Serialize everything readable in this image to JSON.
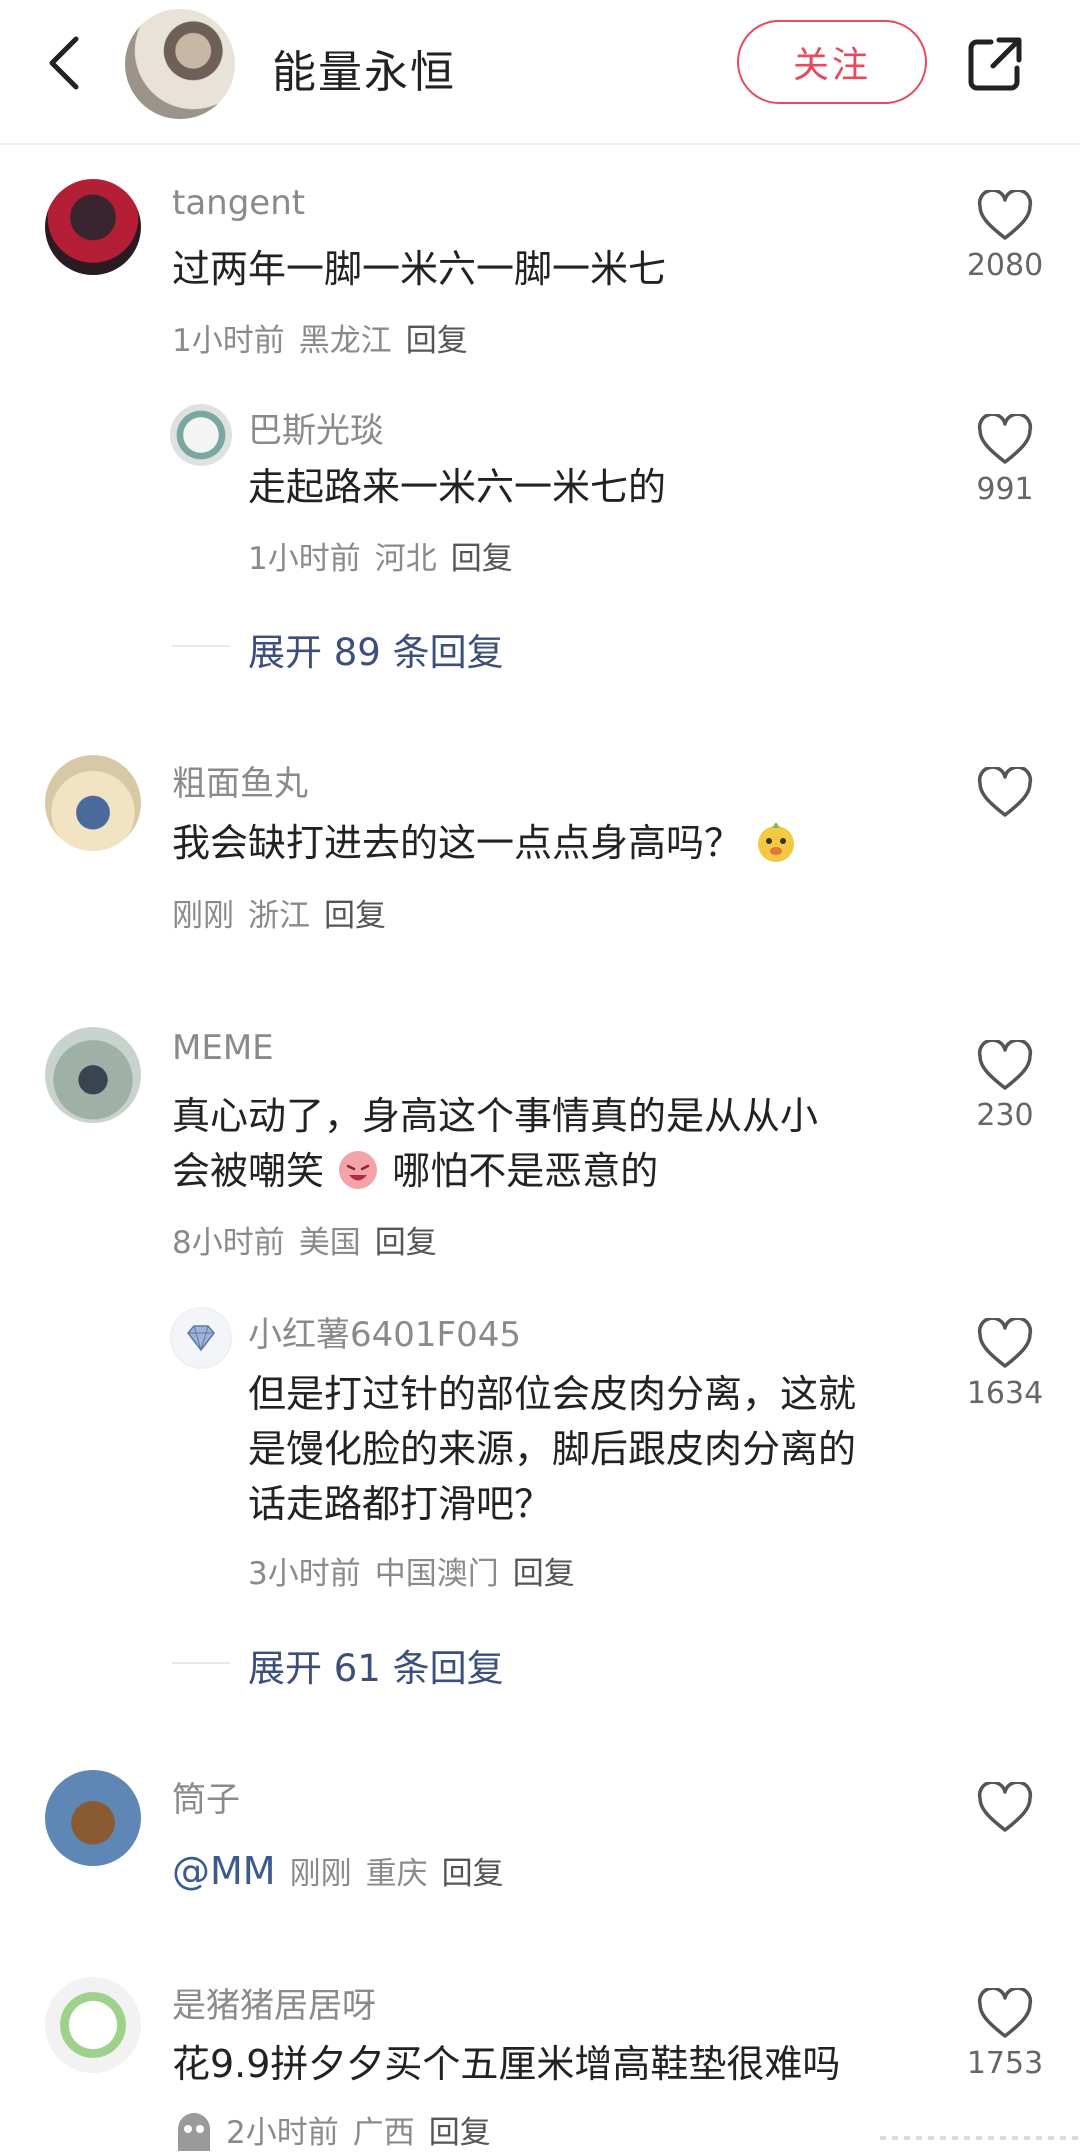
{
  "header": {
    "title": "能量永恒",
    "follow_label": "关注"
  },
  "comments": [
    {
      "username": "tangent",
      "text": "过两年一脚一米六一脚一米七",
      "time": "1小时前",
      "location": "黑龙江",
      "reply": "回复",
      "likes": "2080",
      "sub": {
        "username": "巴斯光琰",
        "text": "走起路来一米六一米七的",
        "time": "1小时前",
        "location": "河北",
        "reply": "回复",
        "likes": "991"
      },
      "expand": "展开 89 条回复"
    },
    {
      "username": "粗面鱼丸",
      "text": "我会缺打进去的这一点点身高吗？",
      "time": "刚刚",
      "location": "浙江",
      "reply": "回复",
      "likes": ""
    },
    {
      "username": "MEME",
      "text_line1": "真心动了，身高这个事情真的是从从小",
      "text_line2a": "会被嘲笑",
      "text_line2b": "哪怕不是恶意的",
      "time": "8小时前",
      "location": "美国",
      "reply": "回复",
      "likes": "230",
      "sub": {
        "username": "小红薯6401F045",
        "text_line1": "但是打过针的部位会皮肉分离，这就",
        "text_line2": "是馒化脸的来源，脚后跟皮肉分离的",
        "text_line3": "话走路都打滑吧？",
        "time": "3小时前",
        "location": "中国澳门",
        "reply": "回复",
        "likes": "1634"
      },
      "expand": "展开 61 条回复"
    },
    {
      "username": "筒子",
      "mention": "@MM",
      "time": "刚刚",
      "location": "重庆",
      "reply": "回复",
      "likes": ""
    },
    {
      "username": "是猪猪居居呀",
      "text": "花9.9拼夕夕买个五厘米增高鞋垫很难吗",
      "time": "2小时前",
      "location": "广西",
      "reply": "回复",
      "likes": "1753"
    }
  ],
  "icons": {
    "back": "chevron-left-icon",
    "share": "share-icon",
    "like": "heart-outline-icon"
  },
  "colors": {
    "accent": "#e64b5c",
    "link": "#3b4f7a",
    "muted": "#8a8a8a"
  }
}
